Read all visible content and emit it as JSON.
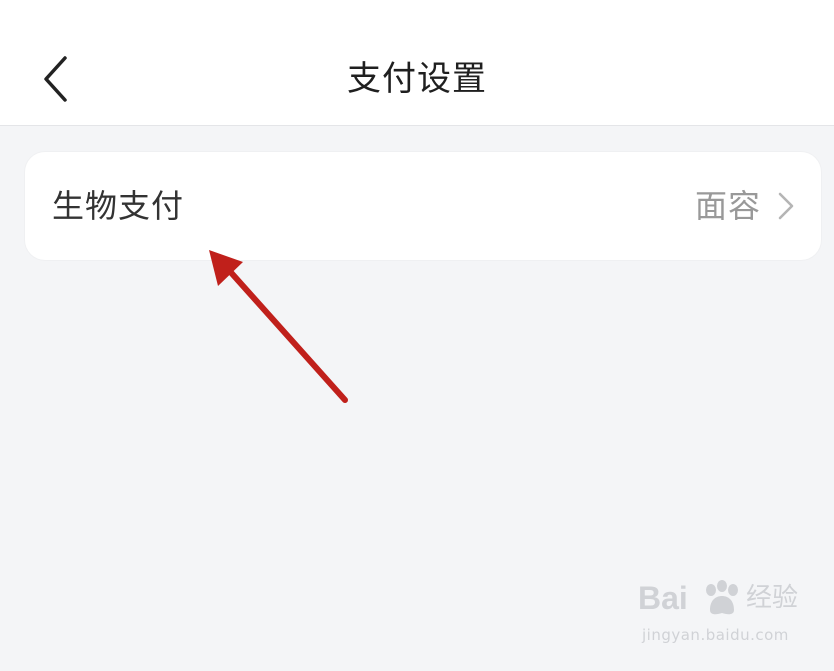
{
  "header": {
    "title": "支付设置",
    "back_icon": "chevron-left-icon"
  },
  "settings": {
    "items": [
      {
        "label": "生物支付",
        "value": "面容",
        "icon": "chevron-right-icon"
      }
    ]
  },
  "annotation": {
    "color": "#c0201b"
  },
  "watermark": {
    "brand_left": "Bai",
    "brand_right": "经验",
    "url": "jingyan.baidu.com"
  },
  "colors": {
    "background": "#f4f5f7",
    "card": "#ffffff",
    "label": "#333333",
    "value": "#999999"
  }
}
